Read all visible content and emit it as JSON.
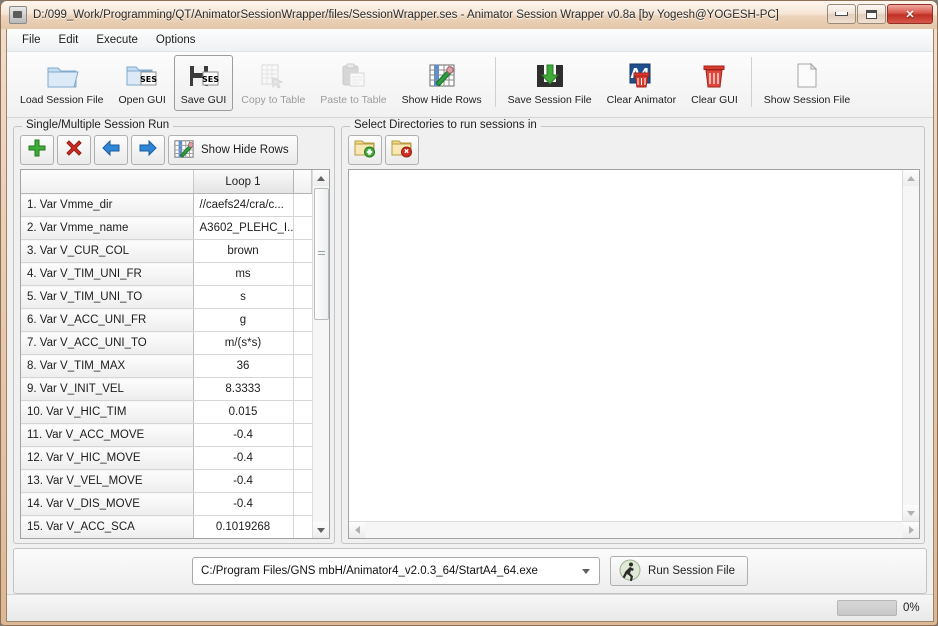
{
  "window": {
    "title": "D:/099_Work/Programming/QT/AnimatorSessionWrapper/files/SessionWrapper.ses - Animator Session Wrapper v0.8a [by Yogesh@YOGESH-PC]",
    "minimize_label": "Minimize",
    "maximize_label": "Maximize",
    "close_label": "Close"
  },
  "menu": {
    "items": [
      {
        "label": "File"
      },
      {
        "label": "Edit"
      },
      {
        "label": "Execute"
      },
      {
        "label": "Options"
      }
    ]
  },
  "toolbar": {
    "buttons": [
      {
        "label": "Load Session File",
        "icon": "folder-icon",
        "state": "normal"
      },
      {
        "label": "Open GUI",
        "icon": "folder-ses-icon",
        "state": "normal"
      },
      {
        "label": "Save GUI",
        "icon": "floppy-ses-icon",
        "state": "pressed"
      },
      {
        "label": "Copy to Table",
        "icon": "copy-icon",
        "state": "disabled"
      },
      {
        "label": "Paste to Table",
        "icon": "paste-icon",
        "state": "disabled"
      },
      {
        "label": "Show Hide Rows",
        "icon": "grid-pencil-icon",
        "state": "normal"
      },
      {
        "label": "Save Session File",
        "icon": "save-down-arrow-icon",
        "state": "normal"
      },
      {
        "label": "Clear Animator",
        "icon": "a4-trash-icon",
        "state": "normal"
      },
      {
        "label": "Clear GUI",
        "icon": "trash-icon",
        "state": "normal"
      },
      {
        "label": "Show Session File",
        "icon": "document-icon",
        "state": "normal"
      }
    ]
  },
  "left_panel": {
    "title": "Single/Multiple Session Run",
    "tools": {
      "add_label": "Add Row",
      "delete_label": "Delete Row",
      "left_label": "Move Left",
      "right_label": "Move Right",
      "show_hide_rows_label": "Show Hide Rows"
    },
    "table": {
      "headers": [
        "",
        "Loop 1"
      ],
      "rows": [
        {
          "name": "1. Var Vmme_dir",
          "value": "//caefs24/cra/c...",
          "align": "left"
        },
        {
          "name": "2. Var Vmme_name",
          "value": "A3602_PLEHC_I...",
          "align": "left"
        },
        {
          "name": "3. Var V_CUR_COL",
          "value": "brown",
          "align": "center"
        },
        {
          "name": "4. Var V_TIM_UNI_FR",
          "value": "ms",
          "align": "center"
        },
        {
          "name": "5. Var V_TIM_UNI_TO",
          "value": "s",
          "align": "center"
        },
        {
          "name": "6. Var V_ACC_UNI_FR",
          "value": "g",
          "align": "center"
        },
        {
          "name": "7. Var V_ACC_UNI_TO",
          "value": "m/(s*s)",
          "align": "center"
        },
        {
          "name": "8. Var V_TIM_MAX",
          "value": "36",
          "align": "center"
        },
        {
          "name": "9. Var V_INIT_VEL",
          "value": "8.3333",
          "align": "center"
        },
        {
          "name": "10. Var V_HIC_TIM",
          "value": "0.015",
          "align": "center"
        },
        {
          "name": "11. Var V_ACC_MOVE",
          "value": "-0.4",
          "align": "center"
        },
        {
          "name": "12. Var V_HIC_MOVE",
          "value": "-0.4",
          "align": "center"
        },
        {
          "name": "13. Var V_VEL_MOVE",
          "value": "-0.4",
          "align": "center"
        },
        {
          "name": "14. Var V_DIS_MOVE",
          "value": "-0.4",
          "align": "center"
        },
        {
          "name": "15. Var V_ACC_SCA",
          "value": "0.1019268",
          "align": "center"
        }
      ]
    }
  },
  "right_panel": {
    "title": "Select Directories to run sessions in",
    "tools": {
      "add_dir_label": "Add Directory",
      "remove_dir_label": "Remove Directory"
    },
    "list_items": []
  },
  "run_bar": {
    "executable_path": "C:/Program Files/GNS mbH/Animator4_v2.0.3_64/StartA4_64.exe",
    "run_label": "Run Session File",
    "run_icon": "runner-icon"
  },
  "status_bar": {
    "progress_percent": "0%",
    "progress_value": 0
  },
  "colors": {
    "accent_blue": "#2a6bb0",
    "danger_red": "#cc2b22",
    "success_green": "#3f9a33",
    "frame_tan": "#dcb894",
    "window_bg": "#f0f0f0"
  }
}
